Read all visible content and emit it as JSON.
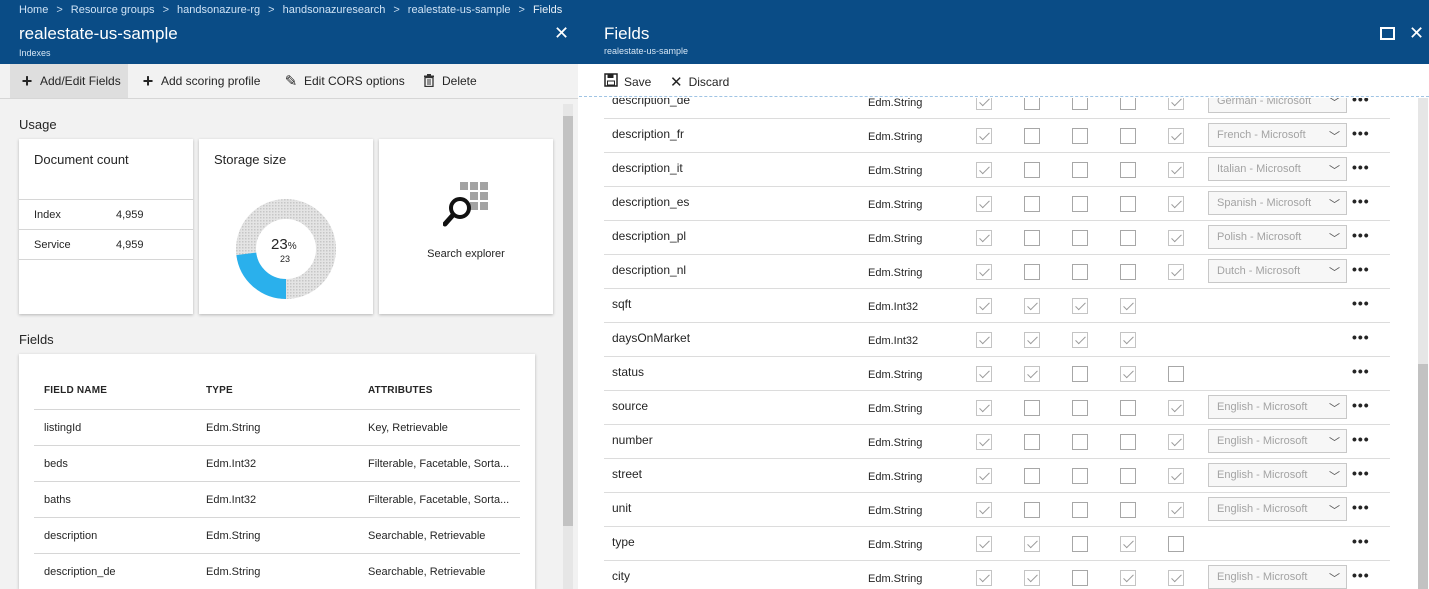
{
  "breadcrumb": [
    "Home",
    "Resource groups",
    "handsonazure-rg",
    "handsonazuresearch",
    "realestate-us-sample",
    "Fields"
  ],
  "left_blade": {
    "title": "realestate-us-sample",
    "subtitle": "Indexes",
    "toolbar": [
      {
        "icon": "plus-icon",
        "label": "Add/Edit Fields"
      },
      {
        "icon": "plus-icon",
        "label": "Add scoring profile"
      },
      {
        "icon": "pencil-icon",
        "label": "Edit CORS options"
      },
      {
        "icon": "trash-icon",
        "label": "Delete"
      }
    ],
    "usage": {
      "title": "Usage",
      "document_count": {
        "title": "Document count",
        "rows": [
          {
            "label": "Index",
            "value": "4,959"
          },
          {
            "label": "Service",
            "value": "4,959"
          }
        ]
      },
      "storage_size": {
        "title": "Storage size",
        "percent": "23",
        "percent_sign": "%",
        "sub": "23",
        "fill_fraction": 0.23
      },
      "search_explorer": {
        "label": "Search explorer"
      }
    },
    "fields": {
      "title": "Fields",
      "headers": {
        "name": "FIELD NAME",
        "type": "TYPE",
        "attributes": "ATTRIBUTES"
      },
      "rows": [
        {
          "name": "listingId",
          "type": "Edm.String",
          "attributes": "Key, Retrievable"
        },
        {
          "name": "beds",
          "type": "Edm.Int32",
          "attributes": "Filterable, Facetable, Sorta..."
        },
        {
          "name": "baths",
          "type": "Edm.Int32",
          "attributes": "Filterable, Facetable, Sorta..."
        },
        {
          "name": "description",
          "type": "Edm.String",
          "attributes": "Searchable, Retrievable"
        },
        {
          "name": "description_de",
          "type": "Edm.String",
          "attributes": "Searchable, Retrievable"
        }
      ]
    }
  },
  "right_blade": {
    "title": "Fields",
    "subtitle": "realestate-us-sample",
    "toolbar": {
      "save": "Save",
      "discard": "Discard"
    },
    "fields": [
      {
        "name": "description_de",
        "type": "Edm.String",
        "checks": [
          true,
          false,
          false,
          false,
          true
        ],
        "analyzer": "German - Microsoft"
      },
      {
        "name": "description_fr",
        "type": "Edm.String",
        "checks": [
          true,
          false,
          false,
          false,
          true
        ],
        "analyzer": "French - Microsoft"
      },
      {
        "name": "description_it",
        "type": "Edm.String",
        "checks": [
          true,
          false,
          false,
          false,
          true
        ],
        "analyzer": "Italian - Microsoft"
      },
      {
        "name": "description_es",
        "type": "Edm.String",
        "checks": [
          true,
          false,
          false,
          false,
          true
        ],
        "analyzer": "Spanish - Microsoft"
      },
      {
        "name": "description_pl",
        "type": "Edm.String",
        "checks": [
          true,
          false,
          false,
          false,
          true
        ],
        "analyzer": "Polish - Microsoft"
      },
      {
        "name": "description_nl",
        "type": "Edm.String",
        "checks": [
          true,
          false,
          false,
          false,
          true
        ],
        "analyzer": "Dutch - Microsoft"
      },
      {
        "name": "sqft",
        "type": "Edm.Int32",
        "checks": [
          true,
          true,
          true,
          true,
          null
        ],
        "analyzer": null
      },
      {
        "name": "daysOnMarket",
        "type": "Edm.Int32",
        "checks": [
          true,
          true,
          true,
          true,
          null
        ],
        "analyzer": null
      },
      {
        "name": "status",
        "type": "Edm.String",
        "checks": [
          true,
          true,
          false,
          true,
          false
        ],
        "analyzer": null
      },
      {
        "name": "source",
        "type": "Edm.String",
        "checks": [
          true,
          false,
          false,
          false,
          true
        ],
        "analyzer": "English - Microsoft"
      },
      {
        "name": "number",
        "type": "Edm.String",
        "checks": [
          true,
          false,
          false,
          false,
          true
        ],
        "analyzer": "English - Microsoft"
      },
      {
        "name": "street",
        "type": "Edm.String",
        "checks": [
          true,
          false,
          false,
          false,
          true
        ],
        "analyzer": "English - Microsoft"
      },
      {
        "name": "unit",
        "type": "Edm.String",
        "checks": [
          true,
          false,
          false,
          false,
          true
        ],
        "analyzer": "English - Microsoft"
      },
      {
        "name": "type",
        "type": "Edm.String",
        "checks": [
          true,
          true,
          false,
          true,
          false
        ],
        "analyzer": null
      },
      {
        "name": "city",
        "type": "Edm.String",
        "checks": [
          true,
          true,
          false,
          true,
          true
        ],
        "analyzer": "English - Microsoft"
      }
    ]
  },
  "colors": {
    "header": "#0a4c86",
    "storage_used": "#2ab0ec",
    "storage_free": "#d4d4d4"
  }
}
